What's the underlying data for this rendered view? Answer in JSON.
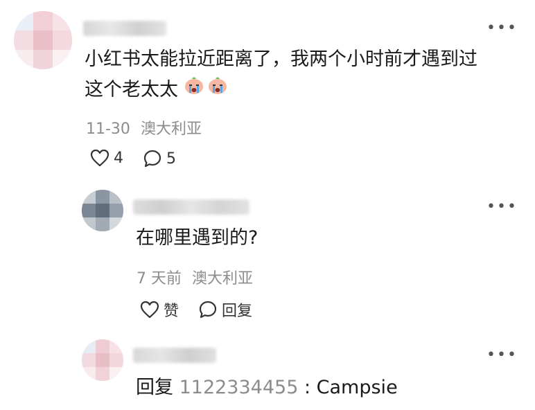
{
  "comments": [
    {
      "text_line1": "小红书太能拉近距离了，我两个小时前才遇到过",
      "text_line2": "这个老太太",
      "emojis": [
        "crying-face-emoji",
        "crying-face-emoji"
      ],
      "date": "11-30",
      "location": "澳大利亚",
      "likes": "4",
      "replies": "5"
    },
    {
      "text": "在哪里遇到的?",
      "date": "7 天前",
      "location": "澳大利亚",
      "like_label": "赞",
      "reply_label": "回复"
    },
    {
      "reply_prefix": "回复",
      "reply_to": "1122334455",
      "separator": " : ",
      "text": "Campsie"
    }
  ],
  "more_icon": "more-horizontal-icon",
  "colors": {
    "meta": "#8c8c8c",
    "reply_target": "#8c8c8c",
    "text": "#1a1a1a"
  }
}
